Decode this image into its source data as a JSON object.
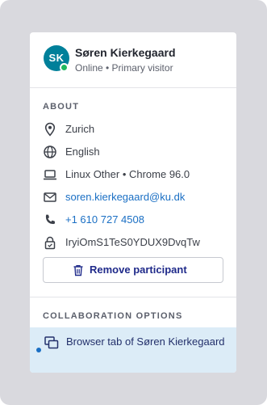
{
  "participant": {
    "initials": "SK",
    "name": "Søren Kierkegaard",
    "status": "Online • Primary visitor",
    "avatar_color": "#00809a",
    "presence_color": "#1fb85f"
  },
  "about": {
    "title": "ABOUT",
    "rows": [
      {
        "icon": "location-pin-icon",
        "text": "Zurich"
      },
      {
        "icon": "globe-icon",
        "text": "English"
      },
      {
        "icon": "laptop-icon",
        "text": "Linux Other • Chrome 96.0"
      },
      {
        "icon": "mail-icon",
        "text": "soren.kierkegaard@ku.dk"
      },
      {
        "icon": "phone-icon",
        "text": "+1 610 727 4508"
      },
      {
        "icon": "lock-icon",
        "text": "IryiOmS1TeS0YDUX9DvqTw"
      }
    ],
    "remove_label": "Remove participant"
  },
  "collaboration": {
    "title": "COLLABORATION OPTIONS",
    "item_label": "Browser tab of Søren Kierkegaard",
    "item_icon": "browser-tabs-icon"
  },
  "colors": {
    "link": "#1a6fc4",
    "button_text": "#1f2a8a",
    "selected_bg": "#dcecf7"
  }
}
